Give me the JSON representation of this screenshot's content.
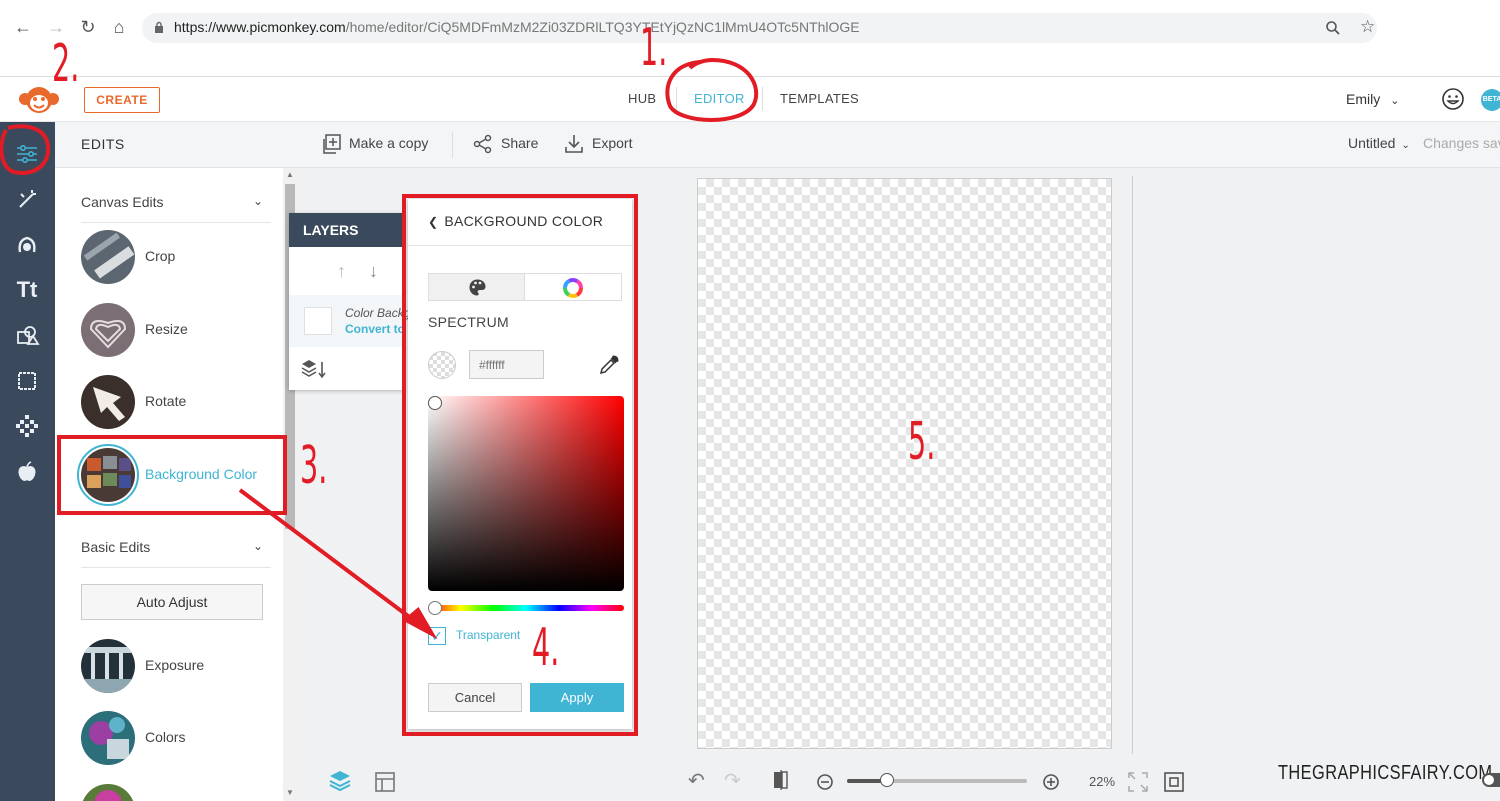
{
  "browser": {
    "url_prefix": "https://www.picmonkey.com",
    "url_rest": "/home/editor/CiQ5MDFmMzM2Zi03ZDRlLTQ3YTEtYjQzNC1lMmU4OTc5NThlOGE"
  },
  "header": {
    "create_label": "CREATE",
    "tabs": [
      {
        "label": "HUB",
        "active": false
      },
      {
        "label": "EDITOR",
        "active": true
      },
      {
        "label": "TEMPLATES",
        "active": false
      }
    ],
    "user_name": "Emily",
    "beta_label": "BETA"
  },
  "edits": {
    "title": "EDITS",
    "sections": [
      {
        "label": "Canvas Edits",
        "tools": [
          "Crop",
          "Resize",
          "Rotate",
          "Background Color"
        ]
      },
      {
        "label": "Basic Edits",
        "button": "Auto Adjust",
        "tools": [
          "Exposure",
          "Colors"
        ]
      }
    ]
  },
  "toolbar": {
    "make_copy": "Make a copy",
    "share": "Share",
    "export": "Export",
    "doc_title": "Untitled",
    "save_status": "Changes saved"
  },
  "layers": {
    "title": "LAYERS",
    "layer_name": "Color Background",
    "convert_label": "Convert to image"
  },
  "bg_color_popup": {
    "title": "BACKGROUND COLOR",
    "spectrum_label": "SPECTRUM",
    "hex_placeholder": "#ffffff",
    "transparent_label": "Transparent",
    "transparent_checked": true,
    "cancel_label": "Cancel",
    "apply_label": "Apply"
  },
  "bottom": {
    "zoom_label": "22%",
    "zoom_fraction": 0.22
  },
  "watermark": "THEGRAPHICSFAIRY.COM",
  "annotations": [
    "1.",
    "2.",
    "3.",
    "4.",
    "5."
  ],
  "colors": {
    "accent": "#3fb4d3",
    "brand_orange": "#e9692c",
    "rail": "#3a4a5c",
    "annotation_red": "#e21c25"
  }
}
